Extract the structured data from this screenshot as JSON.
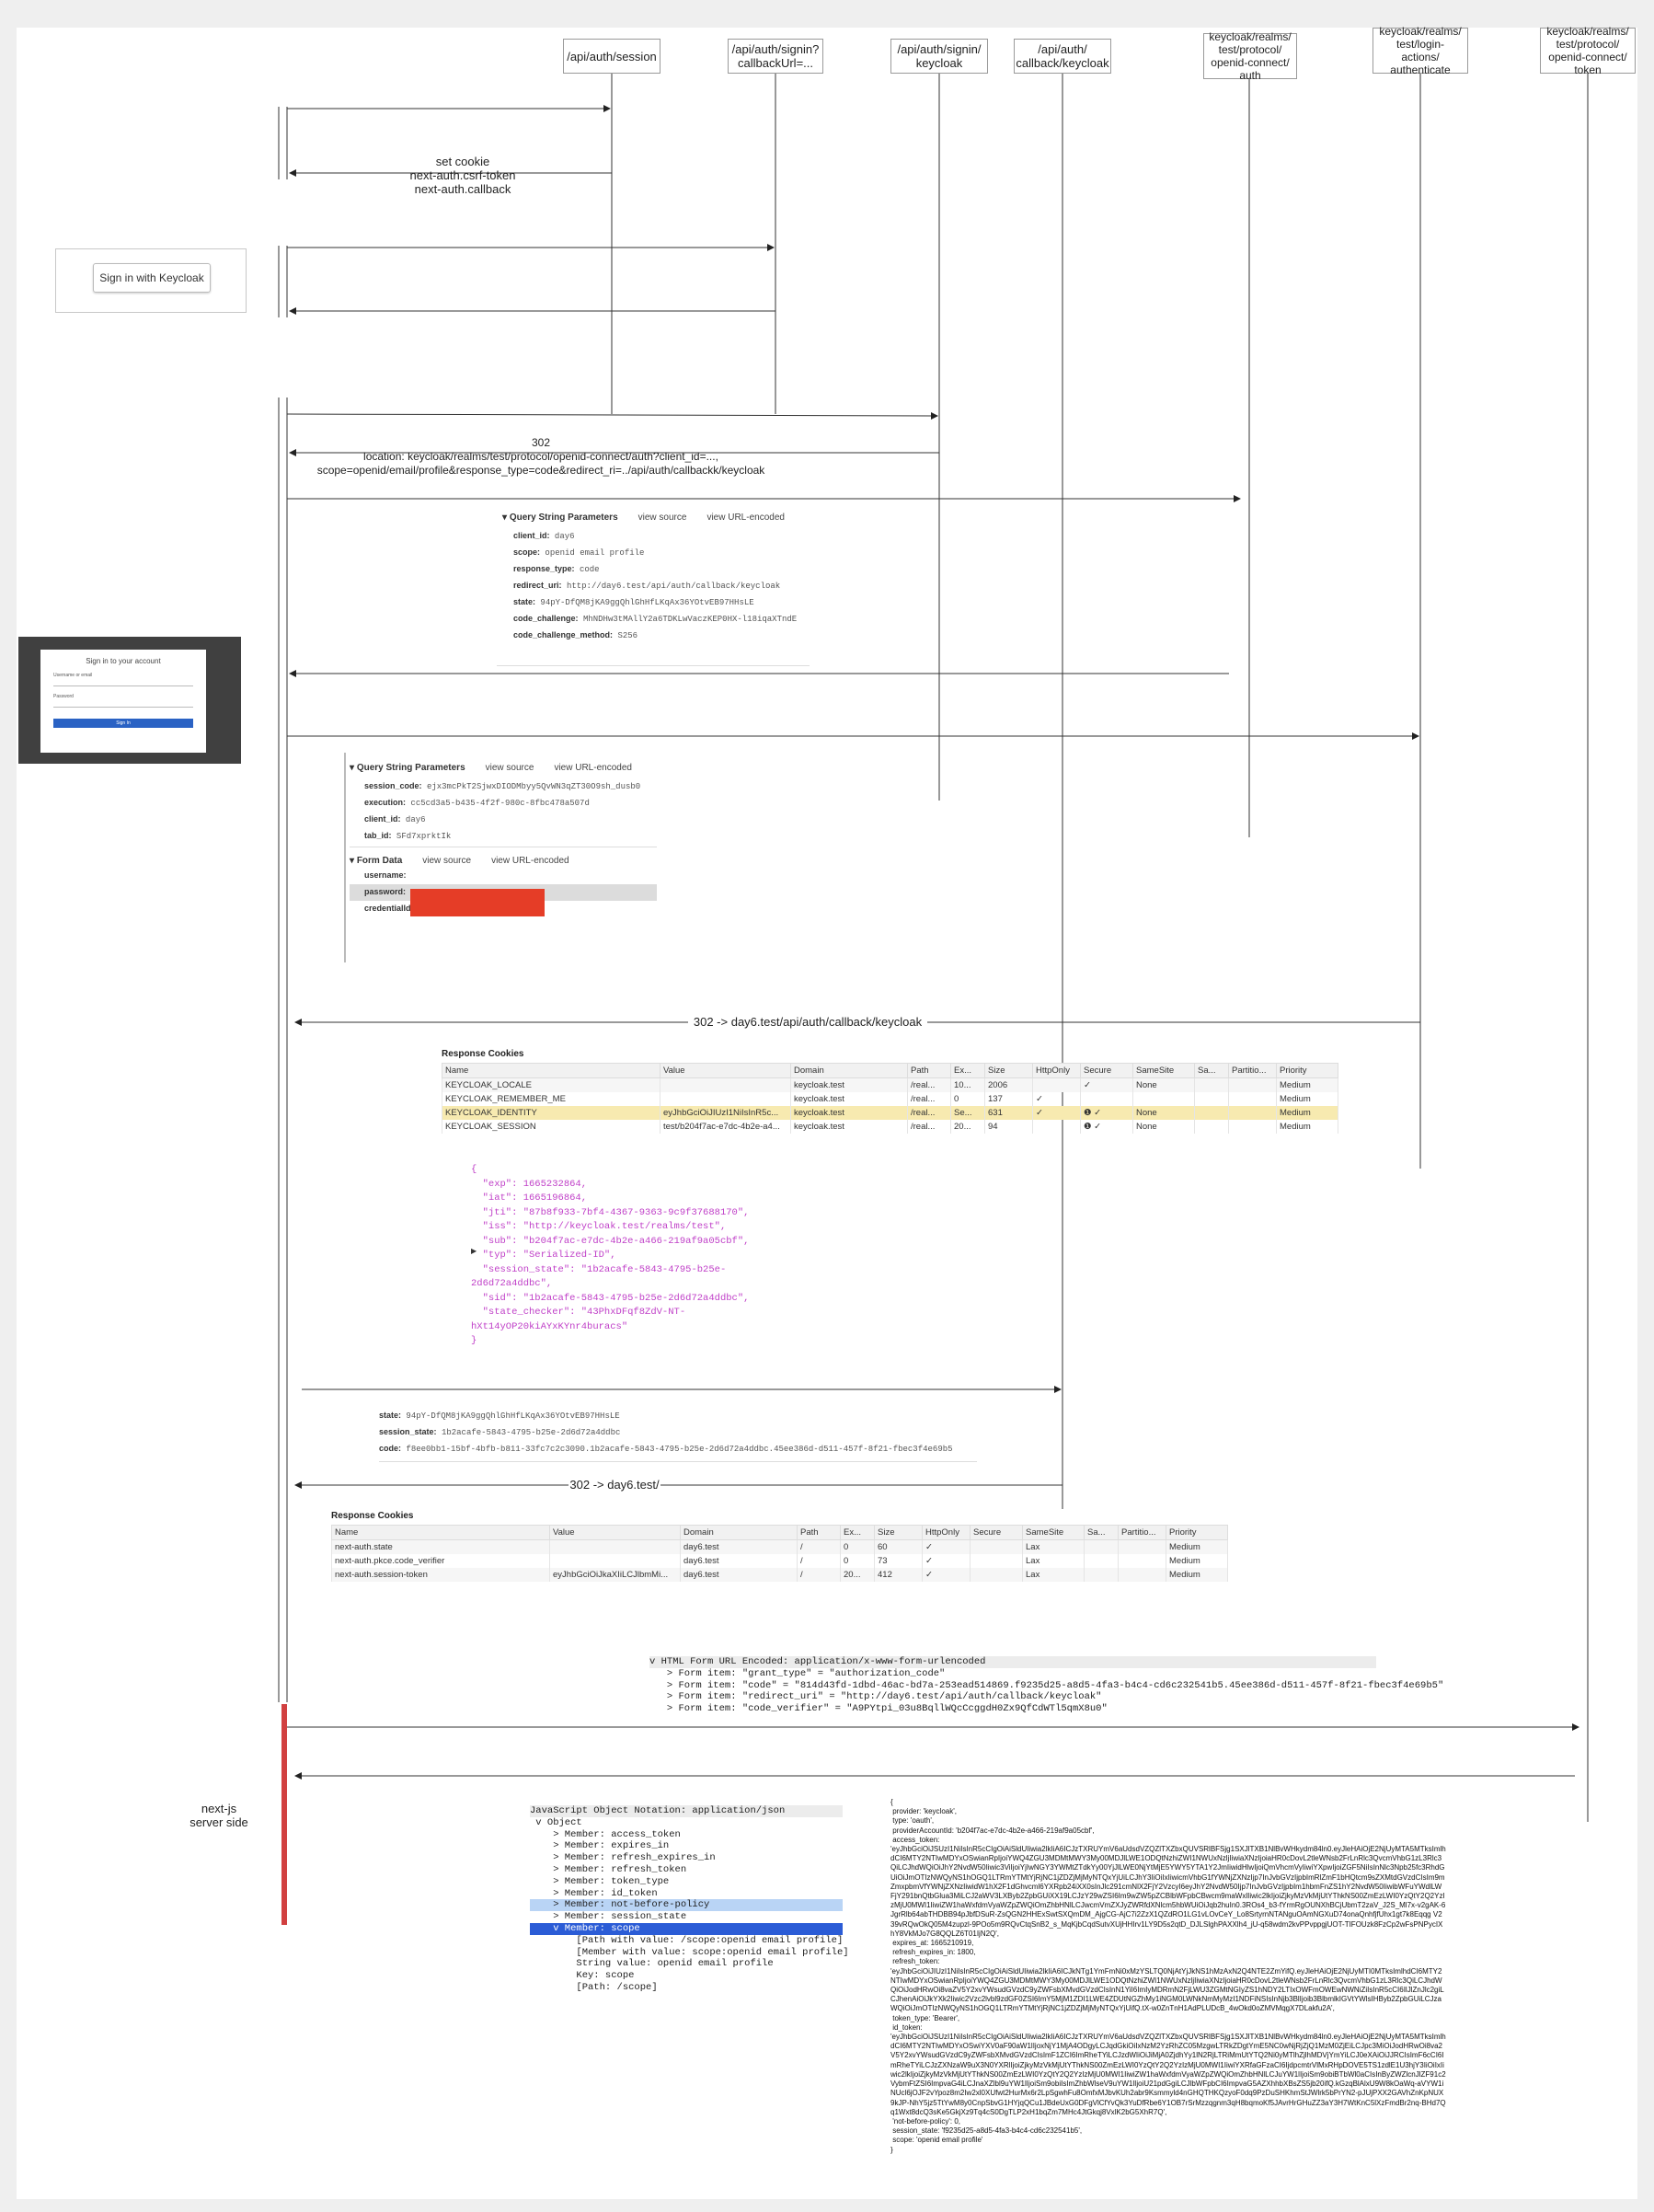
{
  "lifelines": [
    {
      "label": "/api/auth/session"
    },
    {
      "label": "/api/auth/signin?\ncallbackUrl=..."
    },
    {
      "label": "/api/auth/signin/\nkeycloak"
    },
    {
      "label": "/api/auth/\ncallback/keycloak"
    },
    {
      "label": "keycloak/realms/\ntest/protocol/\nopenid-connect/\nauth"
    },
    {
      "label": "keycloak/realms/\ntest/login-\nactions/\nauthenticate"
    },
    {
      "label": "keycloak/realms/\ntest/protocol/\nopenid-connect/\ntoken"
    }
  ],
  "messages": {
    "set_cookie": "set cookie\nnext-auth.csrf-token\nnext-auth.callback",
    "redirect_302": "302\nlocation: keycloak/realms/test/protocol/openid-connect/auth?client_id=...,\nscope=openid/email/profile&response_type=code&redirect_ri=../api/auth/callbackk/keycloak",
    "redirect_callback": "302 -> day6.test/api/auth/callback/keycloak",
    "redirect_home": "302 -> day6.test/",
    "server_side": "next-js\nserver side"
  },
  "signin_button": {
    "label": "Sign in with Keycloak"
  },
  "keycloak_form": {
    "title": "Sign in to your account",
    "username": "Username or email",
    "password": "Password",
    "button": "Sign In"
  },
  "qs1": {
    "title": "Query String Parameters",
    "view_source": "view source",
    "view_url": "view URL-encoded",
    "rows": [
      {
        "k": "client_id:",
        "v": "day6"
      },
      {
        "k": "scope:",
        "v": "openid email profile"
      },
      {
        "k": "response_type:",
        "v": "code"
      },
      {
        "k": "redirect_uri:",
        "v": "http://day6.test/api/auth/callback/keycloak"
      },
      {
        "k": "state:",
        "v": "94pY-DfQM8jKA9ggQhlGhHfLKqAx36YOtvEB97HHsLE"
      },
      {
        "k": "code_challenge:",
        "v": "MhNDHw3tMAllY2a6TDKLwVaczKEP0HX-l18iqaXTndE"
      },
      {
        "k": "code_challenge_method:",
        "v": "S256"
      }
    ]
  },
  "qs2": {
    "title": "Query String Parameters",
    "view_source": "view source",
    "view_url": "view URL-encoded",
    "rows": [
      {
        "k": "session_code:",
        "v": "ejx3mcPkT2SjwxDIODMbyy5QvWN3qZT30O9sh_dusb0"
      },
      {
        "k": "execution:",
        "v": "cc5cd3a5-b435-4f2f-980c-8fbc478a507d"
      },
      {
        "k": "client_id:",
        "v": "day6"
      },
      {
        "k": "tab_id:",
        "v": "SFd7xprktIk"
      }
    ],
    "form_title": "Form Data",
    "form_rows": [
      {
        "k": "username:",
        "v": ""
      },
      {
        "k": "password:",
        "v": ""
      },
      {
        "k": "credentialId:",
        "v": ""
      }
    ]
  },
  "cookies1": {
    "title": "Response Cookies",
    "headers": [
      "Name",
      "Value",
      "Domain",
      "Path",
      "Ex...",
      "Size",
      "HttpOnly",
      "Secure",
      "SameSite",
      "Sa...",
      "Partitio...",
      "Priority"
    ],
    "rows": [
      [
        "KEYCLOAK_LOCALE",
        "",
        "keycloak.test",
        "/real...",
        "10...",
        "2006",
        "",
        "✓",
        "None",
        "",
        "",
        "Medium"
      ],
      [
        "KEYCLOAK_REMEMBER_ME",
        "",
        "keycloak.test",
        "/real...",
        "0",
        "137",
        "✓",
        "",
        "",
        "",
        "",
        "Medium"
      ],
      [
        "KEYCLOAK_IDENTITY",
        "eyJhbGciOiJIUzI1NiIsInR5c...",
        "keycloak.test",
        "/real...",
        "Se...",
        "631",
        "✓",
        "❶ ✓",
        "None",
        "",
        "",
        "Medium"
      ],
      [
        "KEYCLOAK_SESSION",
        "test/b204f7ac-e7dc-4b2e-a4...",
        "keycloak.test",
        "/real...",
        "20...",
        "94",
        "",
        "❶ ✓",
        "None",
        "",
        "",
        "Medium"
      ]
    ]
  },
  "identity_json": [
    "{",
    "  \"exp\": 1665232864,",
    "  \"iat\": 1665196864,",
    "  \"jti\": \"87b8f933-7bf4-4367-9363-9c9f37688170\",",
    "  \"iss\": \"http://keycloak.test/realms/test\",",
    "  \"sub\": \"b204f7ac-e7dc-4b2e-a466-219af9a05cbf\",",
    "  \"typ\": \"Serialized-ID\",",
    "  \"session_state\": \"1b2acafe-5843-4795-b25e-",
    "2d6d72a4ddbc\",",
    "  \"sid\": \"1b2acafe-5843-4795-b25e-2d6d72a4ddbc\",",
    "  \"state_checker\": \"43PhxDFqf8ZdV-NT-",
    "hXt14yOP20kiAYxKYnr4buracs\"",
    "}"
  ],
  "callback_params": [
    {
      "k": "state:",
      "v": "94pY-DfQM8jKA9ggQhlGhHfLKqAx36YOtvEB97HHsLE"
    },
    {
      "k": "session_state:",
      "v": "1b2acafe-5843-4795-b25e-2d6d72a4ddbc"
    },
    {
      "k": "code:",
      "v": "f8ee0bb1-15bf-4bfb-b811-33fc7c2c3090.1b2acafe-5843-4795-b25e-2d6d72a4ddbc.45ee386d-d511-457f-8f21-fbec3f4e69b5"
    }
  ],
  "cookies2": {
    "title": "Response Cookies",
    "headers": [
      "Name",
      "Value",
      "Domain",
      "Path",
      "Ex...",
      "Size",
      "HttpOnly",
      "Secure",
      "SameSite",
      "Sa...",
      "Partitio...",
      "Priority"
    ],
    "rows": [
      [
        "next-auth.state",
        "",
        "day6.test",
        "/",
        "0",
        "60",
        "✓",
        "",
        "Lax",
        "",
        "",
        "Medium"
      ],
      [
        "next-auth.pkce.code_verifier",
        "",
        "day6.test",
        "/",
        "0",
        "73",
        "✓",
        "",
        "Lax",
        "",
        "",
        "Medium"
      ],
      [
        "next-auth.session-token",
        "eyJhbGciOiJkaXIiLCJlbmMi...",
        "day6.test",
        "/",
        "20...",
        "412",
        "✓",
        "",
        "Lax",
        "",
        "",
        "Medium"
      ]
    ]
  },
  "form_encoded": [
    "v HTML Form URL Encoded: application/x-www-form-urlencoded",
    "   > Form item: \"grant_type\" = \"authorization_code\"",
    "   > Form item: \"code\" = \"814d43fd-1dbd-46ac-bd7a-253ead514869.f9235d25-a8d5-4fa3-b4c4-cd6c232541b5.45ee386d-d511-457f-8f21-fbec3f4e69b5\"",
    "   > Form item: \"redirect_uri\" = \"http://day6.test/api/auth/callback/keycloak\"",
    "   > Form item: \"code_verifier\" = \"A9PYtpi_03u8BqllWQcCcggdH0Zx9QfCdWTl5qmX8u0\""
  ],
  "json_tree": [
    {
      "t": "JavaScript Object Notation: application/json",
      "c": "hdr"
    },
    {
      "t": " v Object",
      "c": ""
    },
    {
      "t": "    > Member: access_token",
      "c": ""
    },
    {
      "t": "    > Member: expires_in",
      "c": ""
    },
    {
      "t": "    > Member: refresh_expires_in",
      "c": ""
    },
    {
      "t": "    > Member: refresh_token",
      "c": ""
    },
    {
      "t": "    > Member: token_type",
      "c": ""
    },
    {
      "t": "    > Member: id_token",
      "c": ""
    },
    {
      "t": "    > Member: not-before-policy",
      "c": "hlb"
    },
    {
      "t": "    > Member: session_state",
      "c": ""
    },
    {
      "t": "    v Member: scope",
      "c": "sel"
    },
    {
      "t": "        [Path with value: /scope:openid email profile]",
      "c": ""
    },
    {
      "t": "        [Member with value: scope:openid email profile]",
      "c": ""
    },
    {
      "t": "        String value: openid email profile",
      "c": ""
    },
    {
      "t": "        Key: scope",
      "c": ""
    },
    {
      "t": "        [Path: /scope]",
      "c": ""
    }
  ],
  "token_raw": "{\n provider: 'keycloak',\n type: 'oauth',\n providerAccountId: 'b204f7ac-e7dc-4b2e-a466-219af9a05cbf',\n access_token:\n'eyJhbGciOiJSUzI1NiIsInR5cCIgOiAiSldUIiwia2lkIiA6ICJzTXRUYmV6aUdsdVZQZlTXZbxQUVSRlBFSjg1SXJlTXB1NlBvWHkydm84ln0.eyJleHAiOjE2NjUyMTA5MTksImlhdCI6MTY2NTIwMDYxOSwianRpIjoiYWQ4ZGU3MDMtMWY3My00MDJlLWE1ODQtNzhiZWI1NWUxNzljIiwiaXNzIjoiaHR0cDovL2tleWNsb2FrLnRlc3QvcmVhbG1zL3Rlc3QiLCJhdWQiOiJhY2NvdW50Iiwic3ViIjoiYjIwNGY3YWMtZTdkYy00YjJlLWE0NjYtMjE5YWY5YTA1Y2JmIiwidHlwIjoiQmVhcmVyIiwiYXpwIjoiZGF5NiIsInNlc3Npb25fc3RhdGUiOiJmOTIzNWQyNS1hOGQ1LTRmYTMtYjRjNC1jZDZjMjMyNTQxYjUiLCJhY3IiOiIxIiwicmVhbG1fYWNjZXNzIjp7InJvbGVzIjpbImRlZmF1bHQtcm9sZXMtdGVzdCIsIm9mZmxpbmVfYWNjZXNzIiwidW1hX2F1dGhvcml6YXRpb24iXX0sInJlc291cmNlX2FjY2VzcyI6eyJhY2NvdW50Ijp7InJvbGVzIjpbIm1hbmFnZS1hY2NvdW50IiwibWFuYWdlLWFjY291bnQtbGlua3MiLCJ2aWV3LXByb2ZpbGUiXX19LCJzY29wZSI6Im9wZW5pZCBlbWFpbCBwcm9maWxlIiwic2lkIjoiZjkyMzVkMjUtYThkNS00ZmEzLWI0YzQtY2Q2YzIzMjU0MWI1IiwiZW1haWxfdmVyaWZpZWQiOmZhbHNlLCJwcmVmZXJyZWRfdXNlcm5hbWUiOiJqb2huIn0.3ROs4_b3-fYrmRgOUNXhBCjUbmT2zaV_J2S_Ml7x-v2gAK-6JgrRlb64abTHDBB94pJbfDSuR-ZsQGN2HHExSwtSXQmDM_AjgCG-AjC7i2ZzX1QZdRO1LG1vLOvCeY_Lo8SrtyrnNTANguOAmNGXuD74onaQnhfjfUhx1gt7k8Eqqg V239vRQwOkQ05M4zupzl-9POo5m9RQvCtqSnB2_s_MqKjbCqdSutvXUjHHIrv1LY9D5s2qtD_DJLSlghPAXXlh4_jU-q58wdm2kvPPvppgjUOT-TIFOUzk8FzCp2wFsPNPycIXhY8VkMJo7G8QQLZ6T01IjN2Q',\n expires_at: 1665210919,\n refresh_expires_in: 1800,\n refresh_token:\n'eyJhbGciOiJIUzI1NiIsInR5cCIgOiAiSldUIiwia2lkIiA6ICJkNTg1YmFmNi0xMzYSLTQ0NjAtYjJkNS1hMzAxN2Q4NTE2ZmYifQ.eyJleHAiOjE2NjUyMTI0MTksImlhdCI6MTY2NTIwMDYxOSwianRpIjoiYWQ4ZGU3MDMtMWY3My00MDJlLWE1ODQtNzhiZWI1NWUxNzljIiwiaXNzIjoiaHR0cDovL2tleWNsb2FrLnRlc3QvcmVhbG1zL3Rlc3QiLCJhdWQiOiJodHRwOi8vaZV5Y2xvYWsudGVzdC9yZWFsbXMvdGVzdCIsInN1YiI6ImIyMDRmN2FjLWU3ZGMtNGIyZS1hNDY2LTIxOWFmOWEwNWNiZiIsInR5cCI6IlJlZnJlc2giLCJhenAiOiJkYXk2Iiwic2Vzc2lvbl9zdGF0ZSI6ImY5MjM1ZDI1LWE4ZDUtNGZhMy1iNGM0LWNkNmMyMzI1NDFiNSIsInNjb3BlIjoib3BlbmlkIGVtYWlsIHByb2ZpbGUiLCJzaWQiOiJmOTIzNWQyNS1hOGQ1LTRmYTMtYjRjNC1jZDZjMjMyNTQxYjUifQ.tX-w0ZnTnH1AdPLUDcB_4wOkd0oZMVMqgX7DLakfu2A',\n token_type: 'Bearer',\n id_token:\n'eyJhbGciOiJSUzI1NiIsInR5cCIgOiAiSldUIiwia2lkIiA6ICJzTXRUYmV6aUdsdVZQZlTXZbxQUVSRlBFSjg1SXJlTXB1NlBvWHkydm84ln0.eyJleHAiOjE2NjUyMTA5MTksImlhdCI6MTY2NTIwMDYxOSwiYXV0aF90aW1lIjoxNjY1MjA4ODgyLCJqdGkiOiIxNzM2YzRhZC05MzgwLTRkZDgtYmE5NC0wNjRjZjQ1MzM0ZjEiLCJpc3MiOiJodHRwOi8va2V5Y2xvYWsudGVzdC9yZWFsbXMvdGVzdCIsImF1ZCI6ImRheTYiLCJzdWIiOiJiMjA0ZjdhYy1lN2RjLTRiMmUtYTQ2Ni0yMTlhZjlhMDVjYmYiLCJ0eXAiOiJJRCIsImF6cCI6ImRheTYiLCJzZXNzaW9uX3N0YXRlIjoiZjkyMzVkMjUtYThkNS00ZmEzLWI0YzQtY2Q2YzIzMjU0MWI1IiwiYXRfaGFzaCI6IjdpcmtrVlMxRHpDOVE5TS1zdlE1U3hjY3IiOiIxIiwic2lkIjoiZjkyMzVkMjUtYThkNS00ZmEzLWI0YzQtY2Q2YzIzMjU0MWI1IiwiZW1haWxfdmVyaWZpZWQiOmZhbHNlLCJuYW1lIjoiSm9obiBTbWl0aCIsInByZWZlcnJlZF91c2VybmFtZSI6ImpvaG4iLCJnaXZlbl9uYW1lIjoiSm9obiIsImZhbWlseV9uYW1lIjoiU21pdGgiLCJlbWFpbCI6ImpvaG5AZXhhbXBsZS5jb20ifQ.kGzqBlAlxU9W8kOaWq-aVYW1iNUcl6jOJF2vYpoz8m2Iw2xl0XUfwt2HurMx6r2LpSgwhFu8OmfxMJbvKUh2abr9Ksmmyld4nGHQTHKQzyoF0dq9PzDuSHKhmStJWlrk5bPrYN2-pJUjPXX2GAVhZnKpNUX9kJP-NhY5jz5TtYwM8y0CnpSbvG1HYjqQCu1JBdeUxG0DFgVlCfYvQk3YuDfRbe6Y1OB7rSrMzzqgnm3qH8bqmoKf5JAvrHrGHuZZ3aY3H7WtKnC5lXzFmdBr2nq-BHd7Qq1Wxt8dcQ3sKe5GkjXz9Tq4cS0DgTLP2xH1bqZm7MHc4JtGkqj8VxlK2bG5XhR7Q',\n 'not-before-policy': 0,\n session_state: 'f9235d25-a8d5-4fa3-b4c4-cd6c232541b5',\n scope: 'openid email profile'\n}"
}
